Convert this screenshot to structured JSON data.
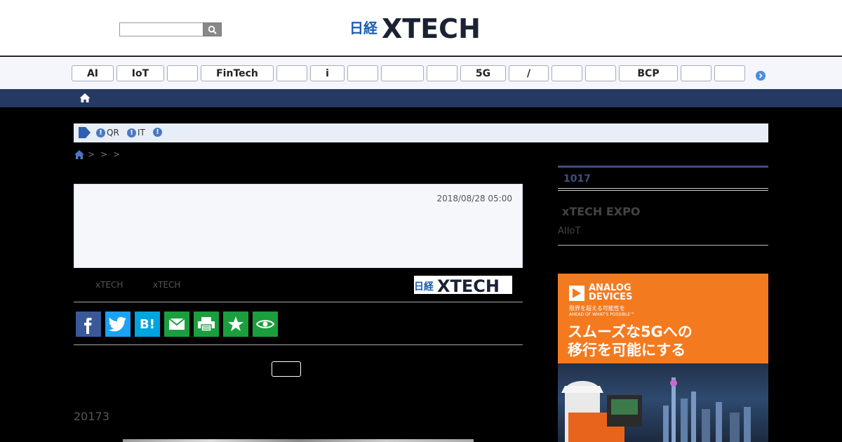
{
  "header": {
    "search": {
      "value": "",
      "placeholder": ""
    },
    "logo_prefix": "日経",
    "logo_text": "XTECH"
  },
  "tagnav": {
    "tags": [
      "AI",
      "IoT",
      "",
      "FinTech",
      "",
      "i",
      "",
      "",
      "",
      "5G",
      "/",
      "",
      "",
      "BCP",
      "",
      ""
    ]
  },
  "notice": {
    "items": [
      "QR",
      "IT",
      ""
    ]
  },
  "breadcrumb": {
    "separators": [
      ">",
      ">",
      ">"
    ]
  },
  "article": {
    "date": "2018/08/28 05:00",
    "byline": [
      "xTECH",
      "xTECH"
    ],
    "section_number": "20173"
  },
  "sidebar": {
    "ranking_title": "1017",
    "expo_title": "xTECH EXPO",
    "expo_sub": "AIIoT"
  },
  "ad": {
    "brand_line1": "ANALOG",
    "brand_line2": "DEVICES",
    "tagline_jp": "限界を超える可能性を",
    "tagline_en": "AHEAD OF WHAT'S POSSIBLE™",
    "headline_line1": "スムーズな5Gへの",
    "headline_line2": "移行を可能にする"
  },
  "share": {
    "icons": [
      "facebook-icon",
      "twitter-icon",
      "hatena-icon",
      "mail-icon",
      "print-icon",
      "star-icon",
      "eye-icon"
    ],
    "colors": [
      "#3b5998",
      "#1da1f2",
      "#00a4de",
      "#1b9e3e",
      "#1b9e3e",
      "#1b9e3e",
      "#1b9e3e"
    ]
  }
}
